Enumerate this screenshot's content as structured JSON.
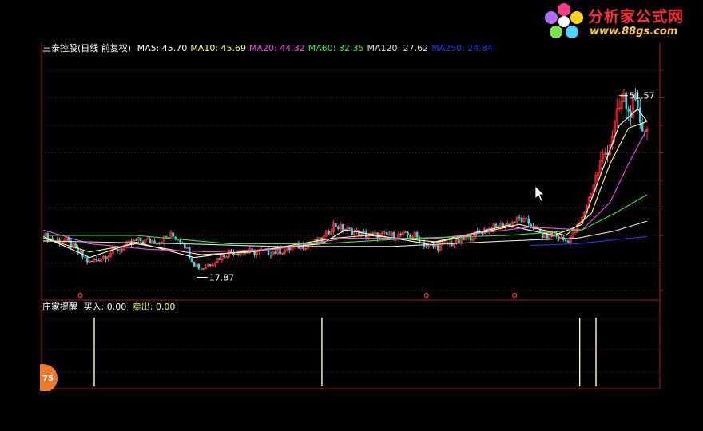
{
  "logo": {
    "title": "分析家公式网",
    "url": "www.88gs.com"
  },
  "header": {
    "stock_title": "三泰控股(日线 前复权)",
    "ma": [
      {
        "label": "MA5:",
        "value": "45.70",
        "color": "#ffffff"
      },
      {
        "label": "MA10:",
        "value": "45.69",
        "color": "#ffff66"
      },
      {
        "label": "MA20:",
        "value": "44.32",
        "color": "#ff44ff"
      },
      {
        "label": "MA60:",
        "value": "32.35",
        "color": "#33ee33"
      },
      {
        "label": "MA120:",
        "value": "27.62",
        "color": "#e0e0e0"
      },
      {
        "label": "MA250:",
        "value": "24.84",
        "color": "#2233ff"
      }
    ]
  },
  "indicator": {
    "title": "庄家提醒",
    "buy_label": "买入:",
    "buy_value": "0.00",
    "sell_label": "卖出:",
    "sell_value": "0.00",
    "badge": "75"
  },
  "chart_data": [
    {
      "type": "candlestick",
      "title": "三泰控股(日线 前复权)",
      "annotations": [
        {
          "text": "51.57",
          "kind": "high"
        },
        {
          "text": "17.87",
          "kind": "low"
        }
      ],
      "ylim": [
        15,
        55
      ],
      "grid": true,
      "close_path": [
        [
          0,
          25
        ],
        [
          5,
          24
        ],
        [
          10,
          24
        ],
        [
          15,
          22
        ],
        [
          20,
          20
        ],
        [
          25,
          21
        ],
        [
          30,
          22
        ],
        [
          35,
          23
        ],
        [
          40,
          24
        ],
        [
          45,
          24
        ],
        [
          50,
          24
        ],
        [
          55,
          25
        ],
        [
          60,
          24
        ],
        [
          65,
          20
        ],
        [
          68,
          19
        ],
        [
          72,
          20
        ],
        [
          80,
          22
        ],
        [
          90,
          22
        ],
        [
          100,
          22
        ],
        [
          110,
          23
        ],
        [
          120,
          24
        ],
        [
          125,
          27
        ],
        [
          130,
          26
        ],
        [
          140,
          25
        ],
        [
          150,
          25
        ],
        [
          160,
          25
        ],
        [
          165,
          23
        ],
        [
          170,
          23
        ],
        [
          180,
          24
        ],
        [
          190,
          26
        ],
        [
          200,
          27
        ],
        [
          205,
          28
        ],
        [
          210,
          27
        ],
        [
          215,
          25
        ],
        [
          220,
          25
        ],
        [
          225,
          24
        ],
        [
          228,
          25
        ],
        [
          232,
          28
        ],
        [
          236,
          33
        ],
        [
          240,
          38
        ],
        [
          244,
          42
        ],
        [
          248,
          48
        ],
        [
          250,
          50
        ],
        [
          252,
          47
        ],
        [
          254,
          49
        ],
        [
          256,
          47
        ],
        [
          258,
          45
        ],
        [
          260,
          44
        ]
      ],
      "series": [
        {
          "name": "MA5",
          "values_path": [
            [
              0,
              24.8
            ],
            [
              20,
              21
            ],
            [
              40,
              23.8
            ],
            [
              65,
              21
            ],
            [
              80,
              21.8
            ],
            [
              120,
              23.5
            ],
            [
              130,
              26
            ],
            [
              165,
              23.5
            ],
            [
              200,
              26.8
            ],
            [
              220,
              25
            ],
            [
              232,
              27
            ],
            [
              240,
              36
            ],
            [
              248,
              45
            ],
            [
              256,
              48
            ],
            [
              260,
              45.7
            ]
          ]
        },
        {
          "name": "MA10",
          "values_path": [
            [
              0,
              24.5
            ],
            [
              20,
              22
            ],
            [
              40,
              23.5
            ],
            [
              68,
              21.5
            ],
            [
              90,
              22
            ],
            [
              125,
              24.5
            ],
            [
              140,
              25
            ],
            [
              170,
              23.8
            ],
            [
              205,
              27
            ],
            [
              225,
              25
            ],
            [
              236,
              29
            ],
            [
              244,
              38
            ],
            [
              252,
              44.5
            ],
            [
              260,
              45.7
            ]
          ]
        },
        {
          "name": "MA20",
          "values_path": [
            [
              0,
              26
            ],
            [
              20,
              23.5
            ],
            [
              45,
              22.5
            ],
            [
              72,
              22
            ],
            [
              100,
              22.5
            ],
            [
              130,
              24.5
            ],
            [
              170,
              24.5
            ],
            [
              210,
              26.5
            ],
            [
              232,
              26
            ],
            [
              244,
              31
            ],
            [
              252,
              38
            ],
            [
              260,
              44.3
            ]
          ]
        },
        {
          "name": "MA60",
          "values_path": [
            [
              0,
              25
            ],
            [
              40,
              25
            ],
            [
              80,
              23.5
            ],
            [
              120,
              23.5
            ],
            [
              160,
              24.5
            ],
            [
              200,
              25
            ],
            [
              232,
              26
            ],
            [
              246,
              29
            ],
            [
              260,
              32.4
            ]
          ]
        },
        {
          "name": "MA120",
          "values_path": [
            [
              0,
              24
            ],
            [
              60,
              23.5
            ],
            [
              100,
              23
            ],
            [
              150,
              23
            ],
            [
              200,
              24
            ],
            [
              230,
              24.5
            ],
            [
              246,
              25.8
            ],
            [
              260,
              27.6
            ]
          ]
        },
        {
          "name": "MA250",
          "values_path": [
            [
              210,
              23.2
            ],
            [
              230,
              23.5
            ],
            [
              246,
              24.2
            ],
            [
              260,
              24.8
            ]
          ]
        }
      ]
    },
    {
      "type": "bar",
      "title": "庄家提醒",
      "series": [
        {
          "name": "买入",
          "x": [
            22,
            120,
            231,
            238
          ],
          "values": [
            1,
            1,
            1,
            1
          ]
        }
      ],
      "ylim": [
        0,
        1
      ]
    }
  ]
}
